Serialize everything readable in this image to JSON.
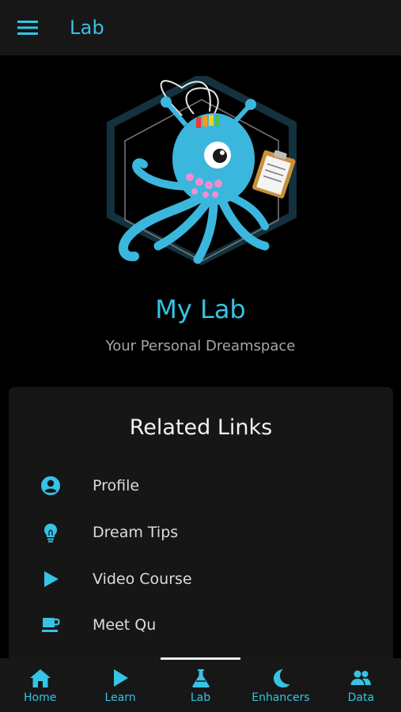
{
  "header": {
    "title": "Lab",
    "menu_icon": "hamburger-menu-icon"
  },
  "hero": {
    "title": "My Lab",
    "subtitle": "Your Personal Dreamspace",
    "image": "octopus-mascot-logo"
  },
  "related": {
    "title": "Related Links",
    "items": [
      {
        "label": "Profile",
        "icon": "profile-icon"
      },
      {
        "label": "Dream Tips",
        "icon": "lightbulb-icon"
      },
      {
        "label": "Video Course",
        "icon": "play-icon"
      },
      {
        "label": "Meet Qu",
        "icon": "coffee-cup-icon"
      }
    ]
  },
  "nav": {
    "items": [
      {
        "label": "Home",
        "icon": "home-icon"
      },
      {
        "label": "Learn",
        "icon": "play-icon"
      },
      {
        "label": "Lab",
        "icon": "flask-icon",
        "active": true
      },
      {
        "label": "Enhancers",
        "icon": "moon-icon"
      },
      {
        "label": "Data",
        "icon": "people-icon"
      }
    ]
  },
  "colors": {
    "accent": "#36c3e4",
    "background": "#000000",
    "surface": "#161616",
    "bar": "#171717"
  }
}
